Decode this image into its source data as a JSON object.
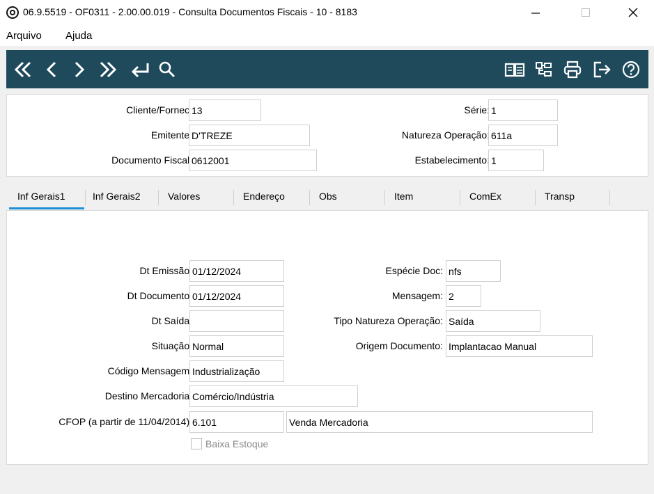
{
  "window": {
    "title": "06.9.5519 - OF0311 - 2.00.00.019 - Consulta Documentos Fiscais - 10 - 8183"
  },
  "menu": {
    "items": [
      "Arquivo",
      "Ajuda"
    ]
  },
  "toolbar": {
    "left_icons": [
      "first-record-icon",
      "previous-record-icon",
      "next-record-icon",
      "last-record-icon",
      "return-icon",
      "search-icon"
    ],
    "right_icons": [
      "manual-book-icon",
      "tree-structure-icon",
      "print-icon",
      "exit-icon",
      "help-icon"
    ],
    "color": "#1f4a5c"
  },
  "header": {
    "cliente_label": "Cliente/Fornec:",
    "cliente_value": "13",
    "emitente_label": "Emitente:",
    "emitente_value": "D'TREZE",
    "documento_label": "Documento Fiscal:",
    "documento_value": "0612001",
    "serie_label": "Série:",
    "serie_value": "1",
    "natureza_label": "Natureza Operação:",
    "natureza_value": "611a",
    "estabelecimento_label": "Estabelecimento:",
    "estabelecimento_value": "1"
  },
  "tabs": {
    "items": [
      "Inf Gerais1",
      "Inf Gerais2",
      "Valores",
      "Endereço",
      "Obs",
      "Item",
      "ComEx",
      "Transp"
    ],
    "active": "Inf Gerais1",
    "accent": "#1f8ed6"
  },
  "form": {
    "dt_emissao_label": "Dt Emissão:",
    "dt_emissao_value": "01/12/2024",
    "dt_documento_label": "Dt Documento:",
    "dt_documento_value": "01/12/2024",
    "dt_saida_label": "Dt Saída:",
    "dt_saida_value": "",
    "situacao_label": "Situação:",
    "situacao_value": "Normal",
    "codigo_mensagem_label": "Código Mensagem:",
    "codigo_mensagem_value": "Industrialização",
    "destino_label": "Destino Mercadoria:",
    "destino_value": "Comércio/Indústria",
    "cfop_label": "CFOP (a partir de 11/04/2014):",
    "cfop_value": "6.101",
    "cfop_desc": "Venda Mercadoria",
    "especie_label": "Espécie Doc:",
    "especie_value": "nfs",
    "mensagem_label": "Mensagem:",
    "mensagem_value": "2",
    "tipo_natureza_label": "Tipo Natureza Operação:",
    "tipo_natureza_value": "Saída",
    "origem_label": "Origem Documento:",
    "origem_value": "Implantacao Manual",
    "baixa_estoque_label": "Baixa Estoque",
    "baixa_estoque_checked": false
  }
}
